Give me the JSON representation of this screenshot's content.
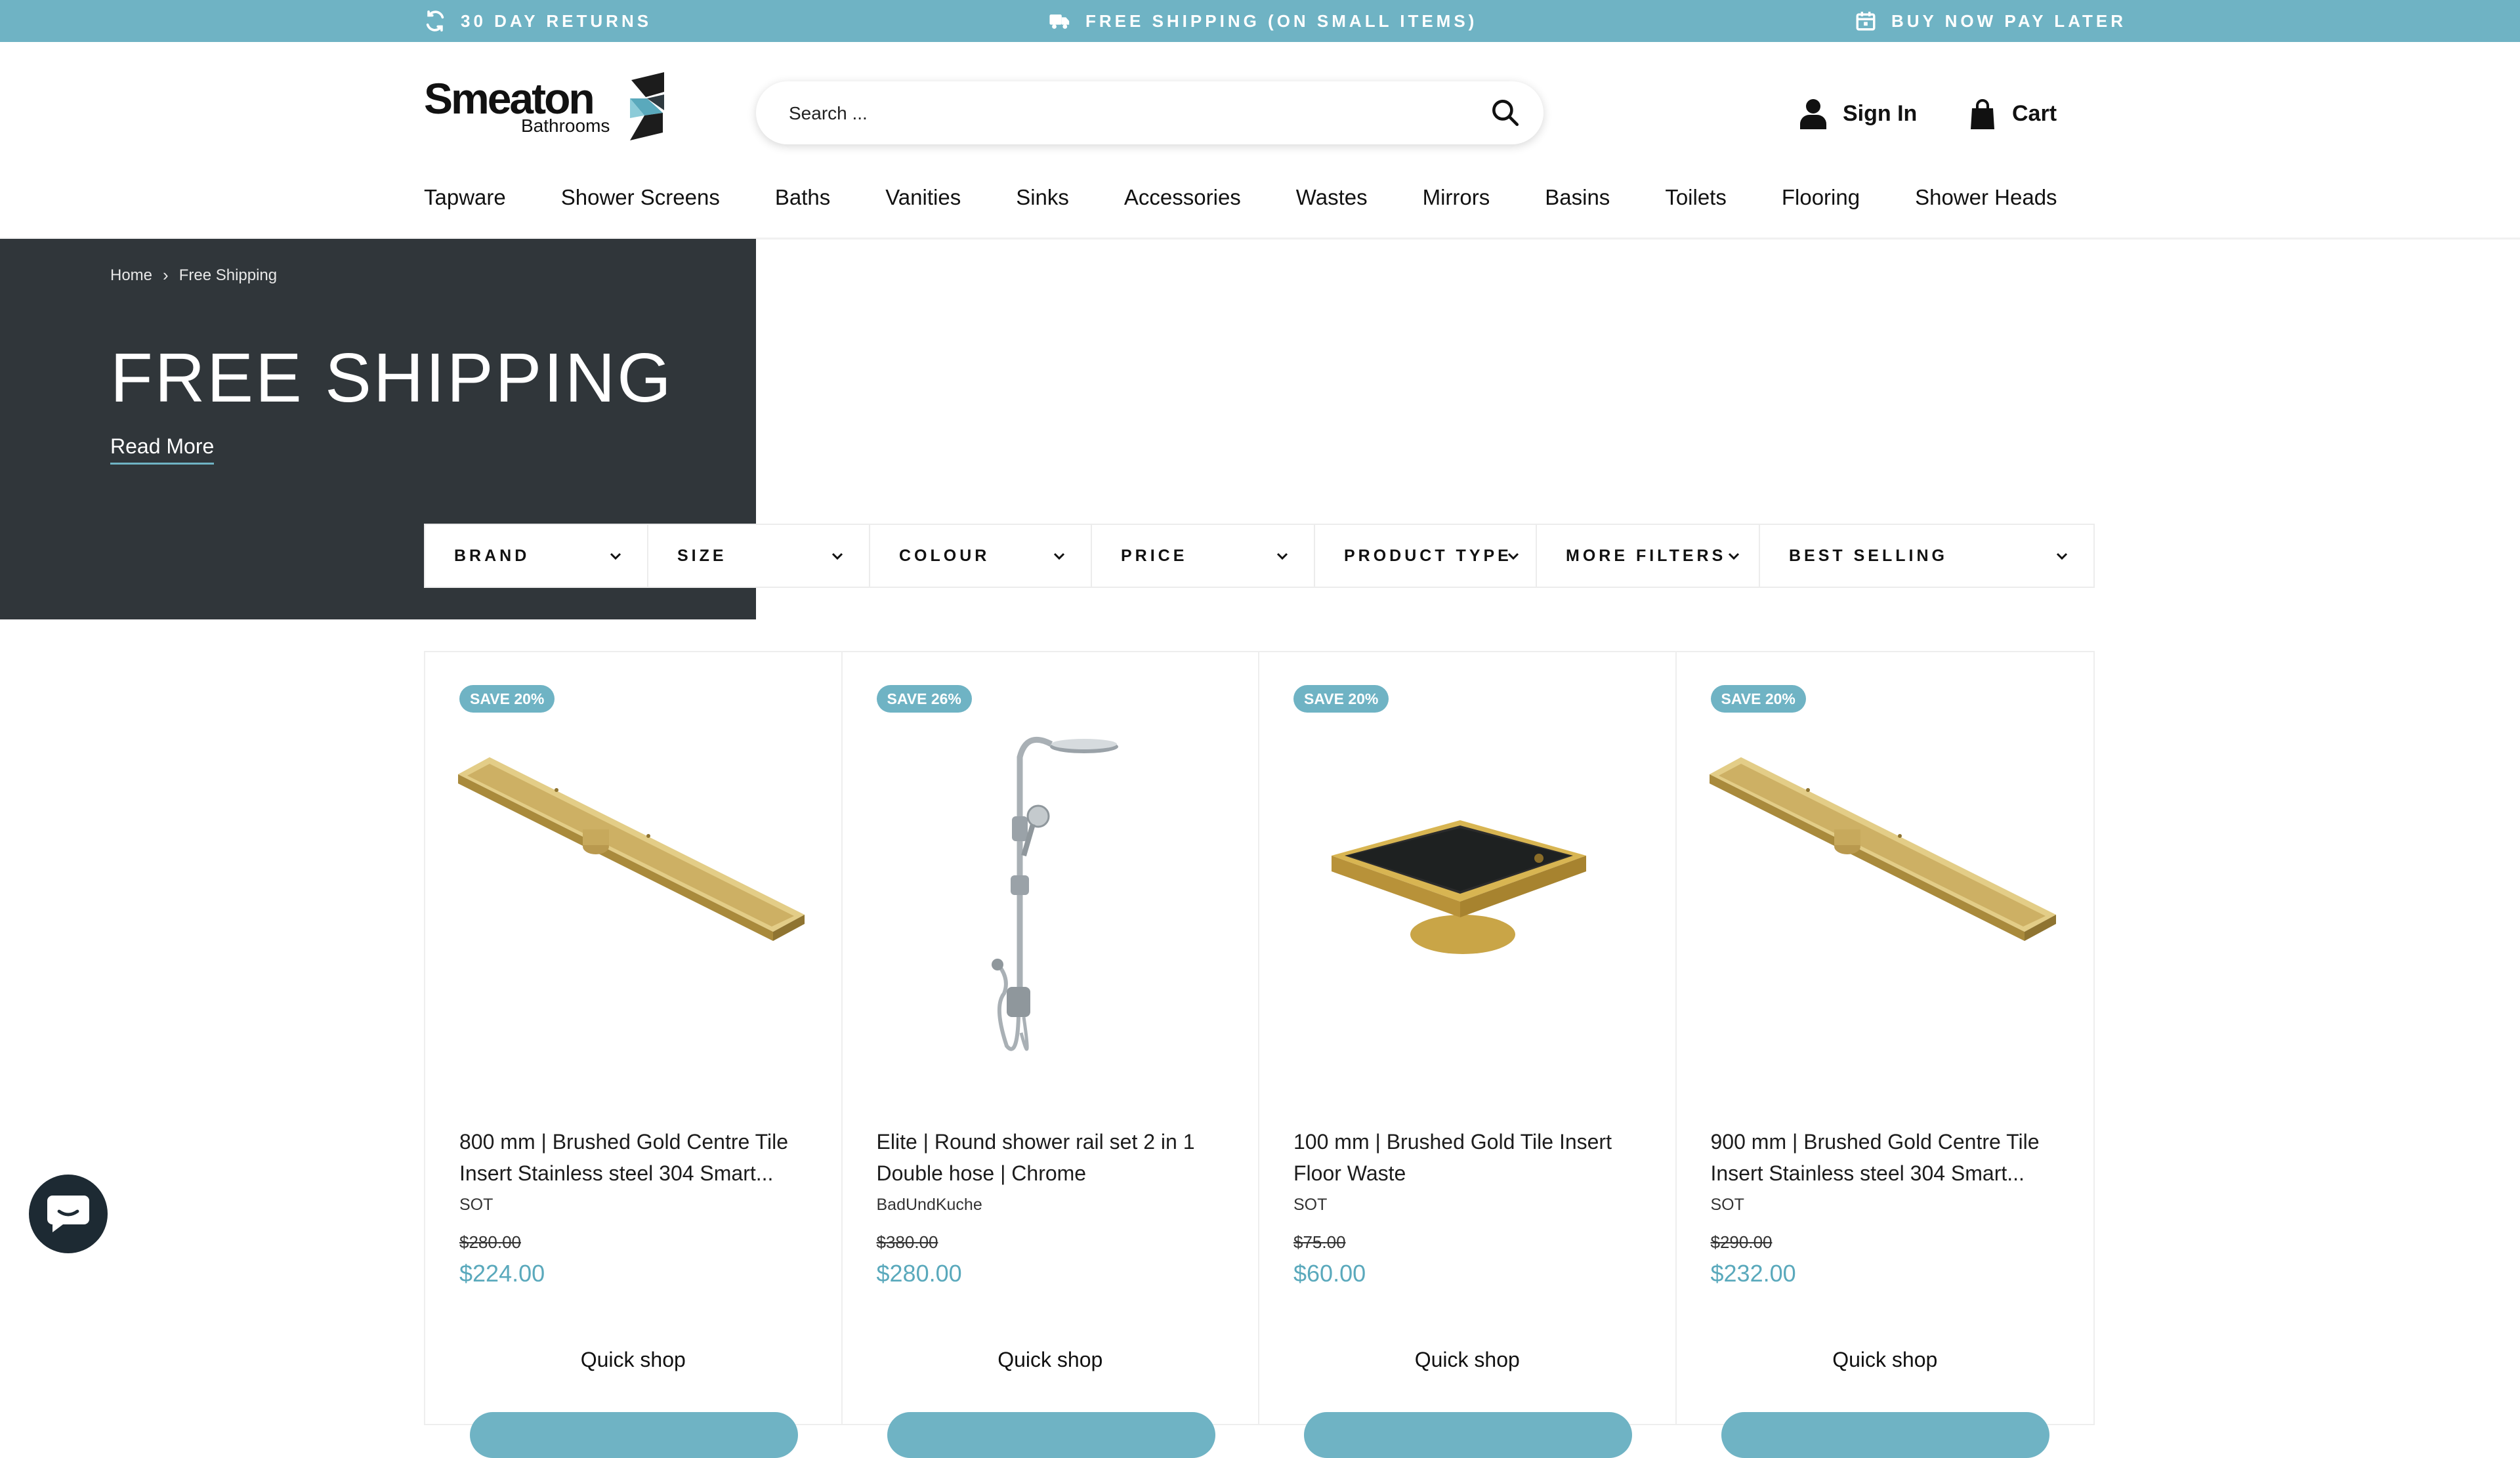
{
  "announcement": {
    "returns": "30 DAY RETURNS",
    "shipping": "FREE SHIPPING (ON SMALL ITEMS)",
    "bnpl": "BUY NOW PAY LATER"
  },
  "header": {
    "logo_text": "Smeaton",
    "logo_sub": "Bathrooms",
    "search_placeholder": "Search ...",
    "sign_in": "Sign In",
    "cart": "Cart"
  },
  "nav": [
    "Tapware",
    "Shower Screens",
    "Baths",
    "Vanities",
    "Sinks",
    "Accessories",
    "Wastes",
    "Mirrors",
    "Basins",
    "Toilets",
    "Flooring",
    "Shower Heads"
  ],
  "hero": {
    "breadcrumb": [
      "Home",
      "Free Shipping"
    ],
    "title": "FREE SHIPPING",
    "read_more": "Read More"
  },
  "filters": [
    "BRAND",
    "SIZE",
    "COLOUR",
    "PRICE",
    "PRODUCT TYPE",
    "MORE FILTERS",
    "BEST SELLING"
  ],
  "products": [
    {
      "badge": "SAVE 20%",
      "title": "800 mm | Brushed Gold Centre Tile Insert Stainless steel 304 Smart...",
      "vendor": "SOT",
      "old_price": "$280.00",
      "price": "$224.00",
      "quick_shop": "Quick shop",
      "image": "gold-linear-drain"
    },
    {
      "badge": "SAVE 26%",
      "title": "Elite | Round shower rail set 2 in 1 Double hose | Chrome",
      "vendor": "BadUndKuche",
      "old_price": "$380.00",
      "price": "$280.00",
      "quick_shop": "Quick shop",
      "image": "chrome-shower-rail"
    },
    {
      "badge": "SAVE 20%",
      "title": "100 mm | Brushed Gold Tile Insert Floor Waste",
      "vendor": "SOT",
      "old_price": "$75.00",
      "price": "$60.00",
      "quick_shop": "Quick shop",
      "image": "gold-square-floor-waste"
    },
    {
      "badge": "SAVE 20%",
      "title": "900 mm | Brushed Gold Centre Tile Insert Stainless steel 304 Smart...",
      "vendor": "SOT",
      "old_price": "$290.00",
      "price": "$232.00",
      "quick_shop": "Quick shop",
      "image": "gold-linear-drain"
    }
  ],
  "colors": {
    "accent": "#6fb3c4",
    "price": "#5aa9bc",
    "hero_bg": "#30363a",
    "chat_bg": "#1d2a33"
  },
  "icons": {
    "returns": "refresh-icon",
    "shipping": "truck-icon",
    "bnpl": "calendar-icon",
    "search": "search-icon",
    "account": "user-icon",
    "cart": "bag-icon",
    "chat": "chat-bubble-icon"
  }
}
